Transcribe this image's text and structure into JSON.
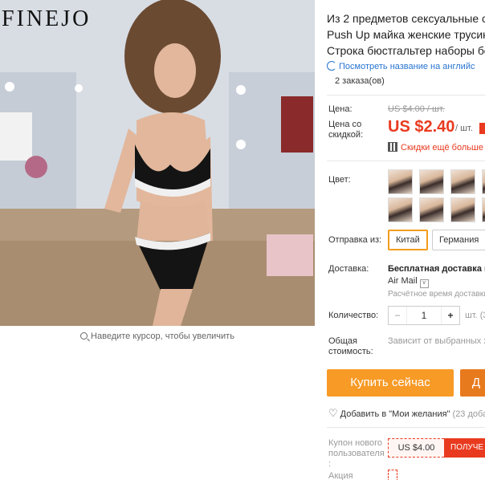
{
  "brand": "FINEJO",
  "gallery": {
    "zoom_hint": "Наведите курсор, чтобы увеличить"
  },
  "product": {
    "title_lines": [
      "Из 2 предметов сексуальные стр",
      "Push Up майка женские трусики",
      "Строка бюстгальтер наборы бел"
    ],
    "translate_link": "Посмотреть название на английс",
    "orders": "2 заказа(ов)"
  },
  "price": {
    "label": "Цена:",
    "old": "US $4.00 / шт.",
    "discount_label": "Цена со скидкой:",
    "new": "US $2.40",
    "per": "/ шт.",
    "coupon_link": "Скидки ещё больше в"
  },
  "color": {
    "label": "Цвет:",
    "swatch_count": 8
  },
  "shipping": {
    "label": "Отправка из:",
    "options": [
      "Китай",
      "Германия"
    ],
    "selected": "Китай"
  },
  "delivery": {
    "label": "Доставка:",
    "value": "Бесплатная доставка в",
    "method": "Air Mail",
    "time": "Расчётное время доставки"
  },
  "quantity": {
    "label": "Количество:",
    "minus": "−",
    "value": "1",
    "plus": "+",
    "unit": "шт. (3"
  },
  "total": {
    "label_lines": [
      "Общая",
      "стоимость:"
    ],
    "note": "Зависит от выбранных х"
  },
  "actions": {
    "buy": "Купить сейчас",
    "cart": "Д"
  },
  "wishlist": {
    "label": "Добавить в \"Мои желания\"",
    "count": "(23 доба"
  },
  "coupon": {
    "label_lines": [
      "Купон нового",
      "пользователя",
      ":"
    ],
    "amount": "US $4.00",
    "get": "ПОЛУЧЕ"
  },
  "promo": {
    "label": "Акция"
  },
  "colors": {
    "accent": "#e93a1f",
    "buy": "#f79a26",
    "selected_border": "#f49c1c",
    "link": "#2874d1"
  }
}
